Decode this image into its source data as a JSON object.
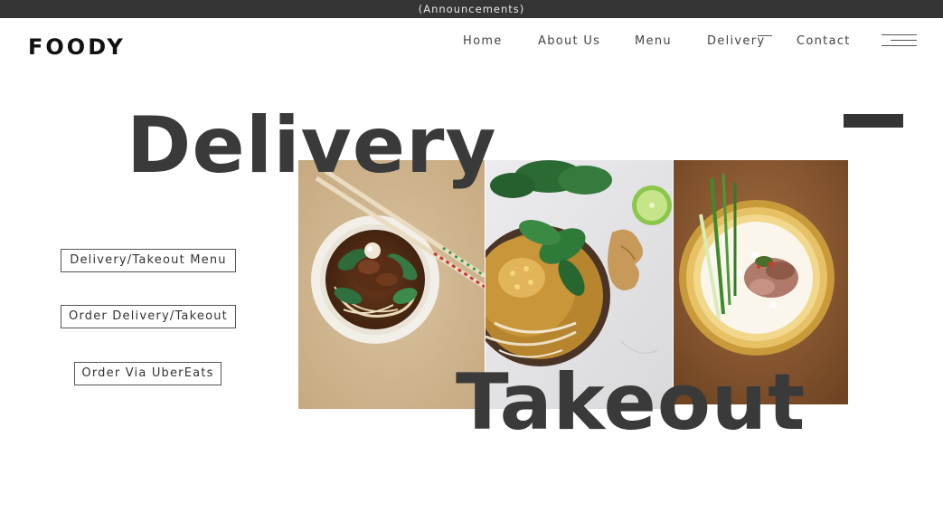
{
  "announcement": "(Announcements)",
  "brand": "FOODY",
  "nav": {
    "items": [
      {
        "label": "Home"
      },
      {
        "label": "About Us"
      },
      {
        "label": "Menu"
      },
      {
        "label": "Delivery",
        "active": true
      },
      {
        "label": "Contact"
      }
    ],
    "menu_icon": "hamburger-menu-icon"
  },
  "hero": {
    "title_top": "Delivery",
    "title_bottom": "Takeout",
    "photos": [
      "noodle-soup-photo",
      "noodle-bowl-ginger-photo",
      "rice-bowl-photo"
    ]
  },
  "buttons": {
    "menu": "Delivery/Takeout Menu",
    "order": "Order Delivery/Takeout",
    "ubereats": "Order Via UberEats"
  },
  "colors": {
    "dark": "#353535",
    "text": "#3a3a3a",
    "background": "#ffffff"
  }
}
